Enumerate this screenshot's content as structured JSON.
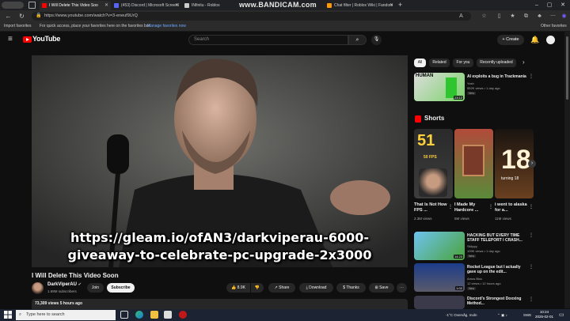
{
  "browser": {
    "tabs": [
      {
        "label": "I Will Delete This Video Soo",
        "active": true,
        "color": "#ff0000"
      },
      {
        "label": "(453) Discord | Microsoft Screenl",
        "active": false,
        "color": "#5865f2"
      },
      {
        "label": "INfinitu - Roblox",
        "active": false,
        "color": "#cccccc"
      },
      {
        "label": "Chat filter | Roblox Wiki | Fandom",
        "active": false,
        "color": "#ff9900"
      }
    ],
    "watermark": "www.BANDICAM.com",
    "url": "https://www.youtube.com/watch?v=3-eneuf9UrQ",
    "favorites": {
      "import": "Import favorites",
      "hint": "For quick access, place your favorites here on the favorites bar.",
      "manage": "Manage favorites now",
      "other": "Other favorites"
    }
  },
  "youtube": {
    "logo_text": "YouTube",
    "logo_sup": "CA",
    "search_placeholder": "Search",
    "create_label": "Create"
  },
  "video": {
    "overlay_line1": "https://gleam.io/ofAN3/darkviperau-6000-",
    "overlay_line2": "giveaway-to-celebrate-pc-upgrade-2x3000",
    "title": "I Will Delete This Video Soon",
    "channel": "DarkViperAU",
    "subscribers": "1.69M subscribers",
    "join": "Join",
    "subscribe": "Subscribe",
    "likes": "8.9K",
    "share": "Share",
    "download": "Download",
    "thanks": "Thanks",
    "save": "Save",
    "views_time": "73,309 views  5 hours ago"
  },
  "chips": [
    "All",
    "Related",
    "For you",
    "Recently uploaded"
  ],
  "recommendations": [
    {
      "title": "AI exploits a bug in Trackmania",
      "channel": "Yosh",
      "meta": "552K views • 1 day ago",
      "badge": "New",
      "duration": "23:12",
      "thumb_text": "HUMAN"
    },
    {
      "title": "HACKING BUT EVERY TIME STAFF TELEPORT I CRASH...",
      "channel": "Skiippy",
      "meta": "109K views • 1 day ago",
      "badge": "New",
      "duration": "14:23"
    },
    {
      "title": "Rocket League but I actually gave up on the edit...",
      "channel": "Amos Bloc",
      "meta": "12 views • 12 hours ago",
      "badge": "New",
      "duration": "1:02"
    },
    {
      "title": "Discord's Strongest Doxxing Method...",
      "channel": "",
      "meta": "",
      "badge": "",
      "duration": ""
    }
  ],
  "shorts": {
    "heading": "Shorts",
    "items": [
      {
        "title": "That Is Not How FPS ...",
        "views": "2.3M views",
        "thumb_text": "51",
        "thumb_sub": "50 FPS"
      },
      {
        "title": "I Made My Hardcore ...",
        "views": "5M views"
      },
      {
        "title": "i went to alaska for a...",
        "views": "11M views",
        "thumb_text": "18",
        "thumb_sub": "turning 18"
      }
    ]
  },
  "taskbar": {
    "search_placeholder": "Type here to search",
    "weather": "-1°C  Overvåg. moln",
    "lang": "SWE",
    "time": "10:24",
    "date": "2025-02-01"
  },
  "colors": {
    "background": "#0f0f0f",
    "accent_red": "#ff0000",
    "subscribe_bg": "#f1f1f1"
  }
}
